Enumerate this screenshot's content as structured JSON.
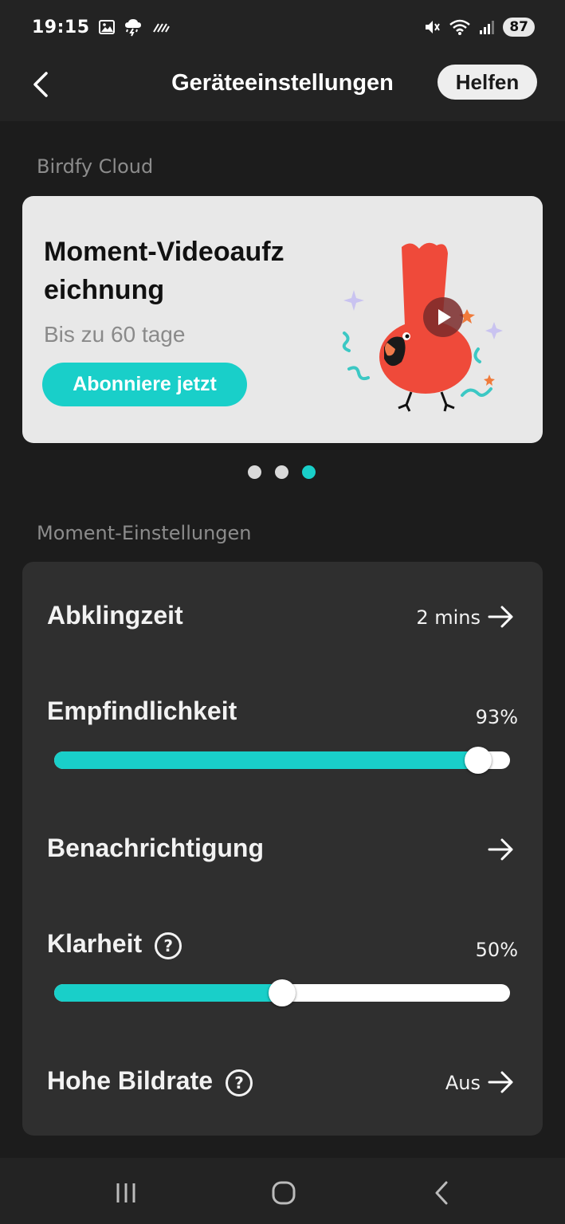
{
  "status_bar": {
    "time": "19:15",
    "battery": "87",
    "left_icons": [
      "image-icon",
      "weather-icon",
      "nfc-icon"
    ],
    "right_icons": [
      "mute-icon",
      "wifi-icon",
      "signal-icon"
    ]
  },
  "header": {
    "title": "Geräteeinstellungen",
    "help_label": "Helfen"
  },
  "cloud_section": {
    "label": "Birdfy Cloud",
    "promo": {
      "title": "Moment-Videoaufzeichnung",
      "subtitle": "Bis zu 60 tage",
      "button_label": "Abonniere jetzt"
    },
    "carousel": {
      "count": 3,
      "active_index": 2
    }
  },
  "moment_section": {
    "label": "Moment-Einstellungen",
    "rows": {
      "cooldown": {
        "label": "Abklingzeit",
        "value": "2 mins"
      },
      "sensitivity": {
        "label": "Empfindlichkeit",
        "value": "93%",
        "level": 0.93
      },
      "notification": {
        "label": "Benachrichtigung"
      },
      "clarity": {
        "label": "Klarheit",
        "value": "50%",
        "level": 0.5
      },
      "high_framerate": {
        "label": "Hohe Bildrate",
        "value": "Aus"
      }
    }
  },
  "colors": {
    "accent": "#19cfc9",
    "background": "#1c1c1c",
    "card": "#2f2f2f",
    "promo_card": "#e8e8e8"
  }
}
